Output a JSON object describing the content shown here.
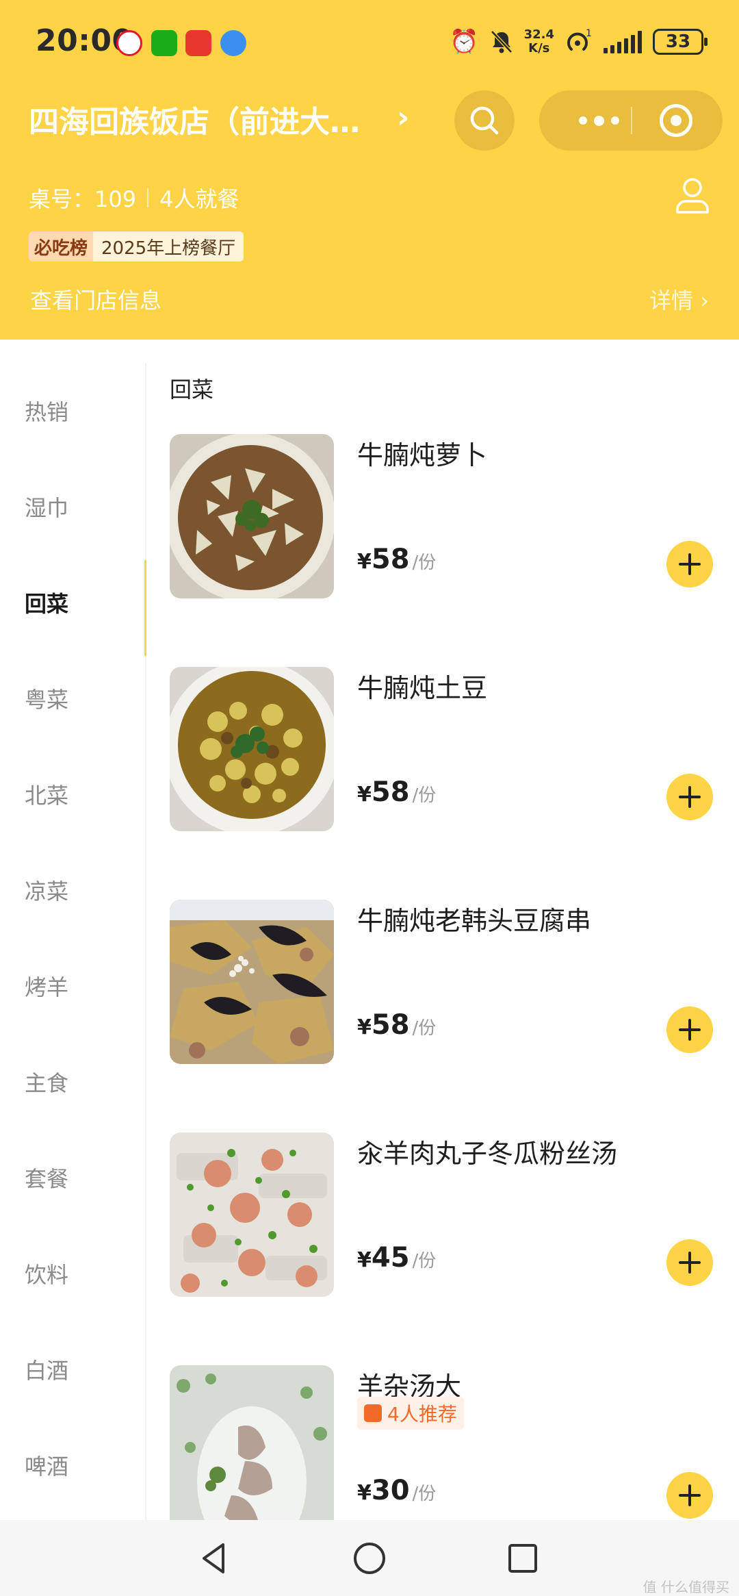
{
  "status_bar": {
    "time": "20:00",
    "network_speed_value": "32.4",
    "network_speed_unit": "K/s",
    "hotspot_count": "1",
    "battery": "33"
  },
  "header": {
    "shop_title": "四海回族饭店（前进大…",
    "table_label": "桌号：109",
    "diners": "4人就餐",
    "rank_logo": "必吃榜",
    "rank_text": "2025年上榜餐厅",
    "store_info": "查看门店信息",
    "details": "详情 ›"
  },
  "categories": [
    {
      "label": "热销"
    },
    {
      "label": "湿巾"
    },
    {
      "label": "回菜"
    },
    {
      "label": "粤菜"
    },
    {
      "label": "北菜"
    },
    {
      "label": "凉菜"
    },
    {
      "label": "烤羊"
    },
    {
      "label": "主食"
    },
    {
      "label": "套餐"
    },
    {
      "label": "饮料"
    },
    {
      "label": "白酒"
    },
    {
      "label": "啤酒"
    }
  ],
  "active_category": "回菜",
  "section_title": "回菜",
  "dishes": [
    {
      "name": "牛腩炖萝卜",
      "yen": "¥",
      "price": "58",
      "unit": "/份"
    },
    {
      "name": "牛腩炖土豆",
      "yen": "¥",
      "price": "58",
      "unit": "/份"
    },
    {
      "name": "牛腩炖老韩头豆腐串",
      "yen": "¥",
      "price": "58",
      "unit": "/份"
    },
    {
      "name": "汆羊肉丸子冬瓜粉丝汤",
      "yen": "¥",
      "price": "45",
      "unit": "/份"
    },
    {
      "name": "羊杂汤大",
      "tag": "4人推荐",
      "yen": "¥",
      "price": "30",
      "unit": "/份"
    }
  ],
  "watermark": "值 什么值得买",
  "colors": {
    "brand_yellow": "#FED446",
    "capsule_yellow": "#E9BE3E",
    "tag_orange": "#f26a2a"
  }
}
